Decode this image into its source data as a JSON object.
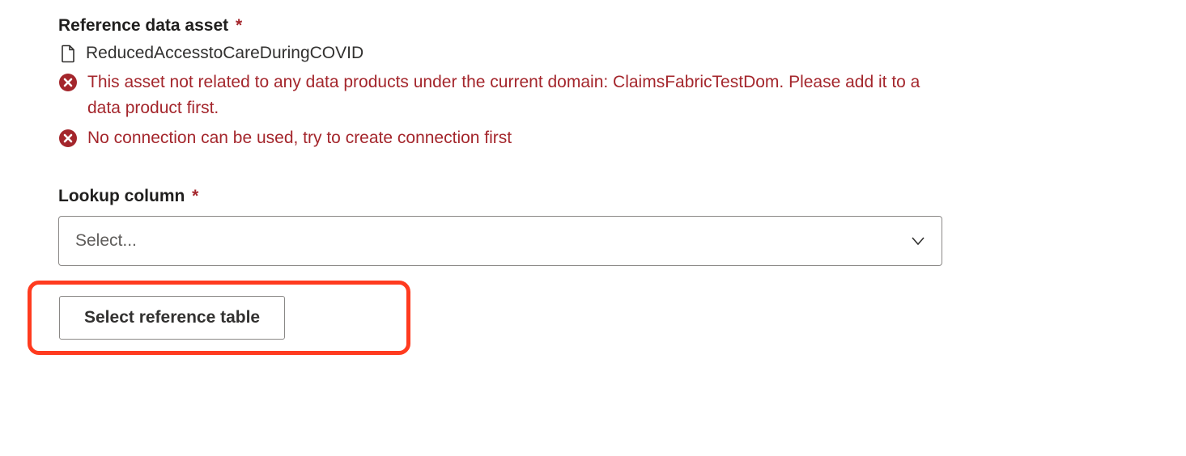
{
  "referenceDataAsset": {
    "label": "Reference data asset",
    "requiredMark": "*",
    "assetName": "ReducedAccesstoCareDuringCOVID",
    "errors": [
      "This asset not related to any data products under the current domain: ClaimsFabricTestDom. Please add it to a data product first.",
      "No connection can be used, try to create connection first"
    ]
  },
  "lookupColumn": {
    "label": "Lookup column",
    "requiredMark": "*",
    "placeholder": "Select..."
  },
  "selectReferenceTable": {
    "label": "Select reference table"
  }
}
